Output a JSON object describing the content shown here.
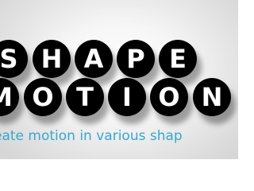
{
  "banner": {
    "title_line_1": [
      "S",
      "H",
      "A",
      "P",
      "E"
    ],
    "title_line_2": [
      "M",
      "O",
      "T",
      "I",
      "O",
      "N"
    ],
    "tagline": "eate motion in various shap",
    "colors": {
      "disc": "#000000",
      "letter": "#ffffff",
      "tagline": "#36a7cf",
      "background": "#f2f2f2"
    }
  }
}
